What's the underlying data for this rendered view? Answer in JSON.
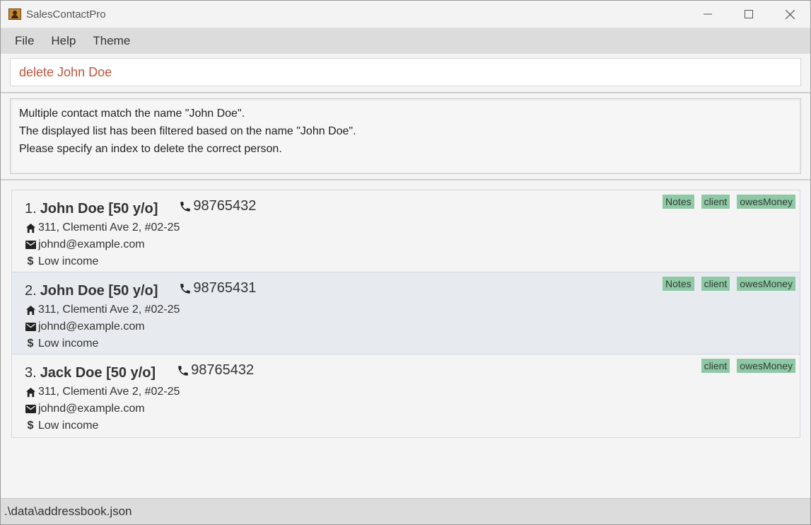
{
  "window": {
    "title": "SalesContactPro",
    "controls": [
      "minimize",
      "maximize",
      "close"
    ]
  },
  "menu": {
    "items": [
      "File",
      "Help",
      "Theme"
    ]
  },
  "command": {
    "value": "delete John Doe",
    "text_color": "#c0543a"
  },
  "result": {
    "lines": [
      "Multiple contact match the name \"John Doe\".",
      "The displayed list has been filtered based on the name \"John Doe\".",
      "Please specify an index to delete the correct person."
    ]
  },
  "contacts": [
    {
      "index": "1.",
      "name": "John Doe [50 y/o]",
      "phone": "98765432",
      "address": "311, Clementi Ave 2, #02-25",
      "email": "johnd@example.com",
      "income": "Low income",
      "tags": [
        "Notes",
        "client",
        "owesMoney"
      ]
    },
    {
      "index": "2.",
      "name": "John Doe [50 y/o]",
      "phone": "98765431",
      "address": "311, Clementi Ave 2, #02-25",
      "email": "johnd@example.com",
      "income": "Low income",
      "tags": [
        "Notes",
        "client",
        "owesMoney"
      ]
    },
    {
      "index": "3.",
      "name": "Jack Doe [50 y/o]",
      "phone": "98765432",
      "address": "311, Clementi Ave 2, #02-25",
      "email": "johnd@example.com",
      "income": "Low income",
      "tags": [
        "client",
        "owesMoney"
      ]
    }
  ],
  "selected_index": 1,
  "status": {
    "path": ".\\data\\addressbook.json"
  },
  "colors": {
    "tag_bg": "#8fc8a5",
    "selected_row": "#e7ebef"
  }
}
